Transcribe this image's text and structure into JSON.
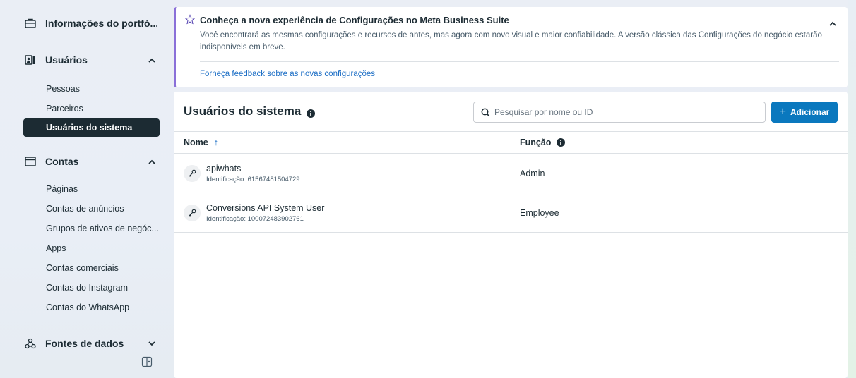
{
  "sidebar": {
    "portfolio": {
      "label": "Informações do portfó..."
    },
    "users": {
      "label": "Usuários",
      "items": [
        "Pessoas",
        "Parceiros",
        "Usuários do sistema"
      ]
    },
    "accounts": {
      "label": "Contas",
      "items": [
        "Páginas",
        "Contas de anúncios",
        "Grupos de ativos de negóc...",
        "Apps",
        "Contas comerciais",
        "Contas do Instagram",
        "Contas do WhatsApp"
      ]
    },
    "datasources": {
      "label": "Fontes de dados"
    }
  },
  "banner": {
    "title": "Conheça a nova experiência de Configurações no Meta Business Suite",
    "body": "Você encontrará as mesmas configurações e recursos de antes, mas agora com novo visual e maior confiabilidade. A versão clássica das Configurações do negócio estarão indisponíveis em breve.",
    "link": "Forneça feedback sobre as novas configurações"
  },
  "panel": {
    "title": "Usuários do sistema",
    "search_placeholder": "Pesquisar por nome ou ID",
    "add_label": "Adicionar",
    "col_name": "Nome",
    "col_role": "Função"
  },
  "rows": [
    {
      "name": "apiwhats",
      "id": "Identificação: 61567481504729",
      "role": "Admin"
    },
    {
      "name": "Conversions API System User",
      "id": "Identificação: 100072483902761",
      "role": "Employee"
    }
  ],
  "colors": {
    "accent": "#0a78be",
    "active_nav": "#1c2b33",
    "banner_border": "#8a6fd8",
    "link": "#1c6ec5"
  }
}
